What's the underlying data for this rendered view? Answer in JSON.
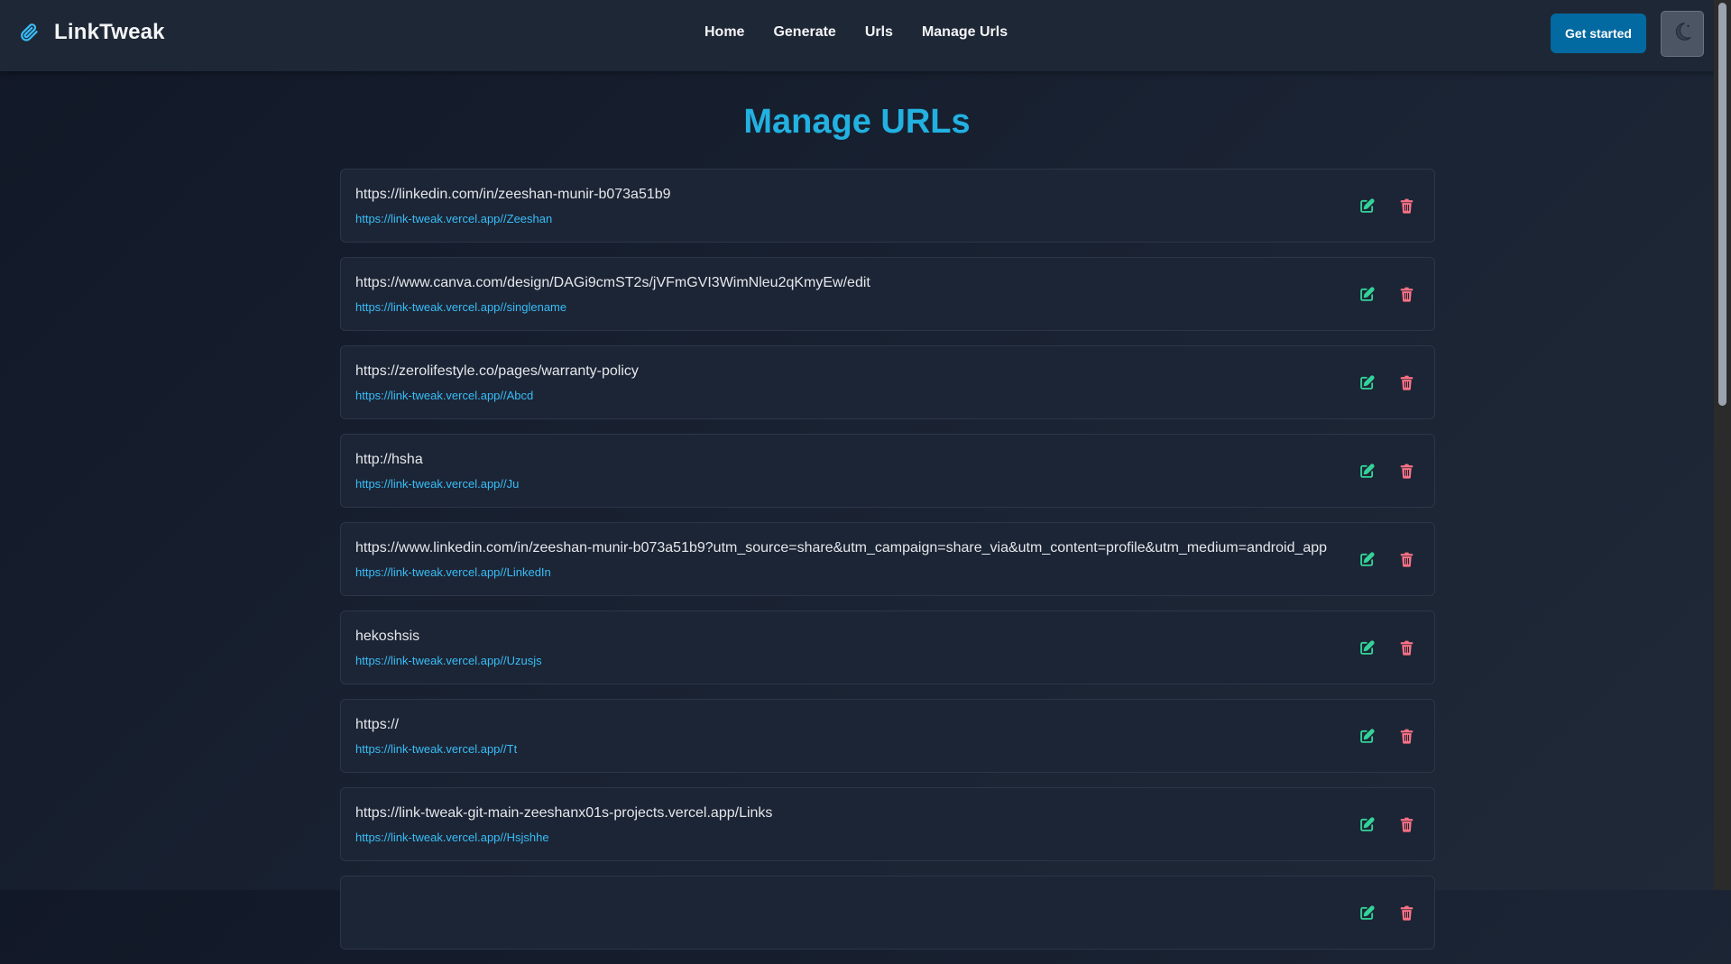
{
  "app": {
    "name": "LinkTweak"
  },
  "nav": {
    "links": [
      "Home",
      "Generate",
      "Urls",
      "Manage Urls"
    ],
    "cta_label": "Get started"
  },
  "page": {
    "title": "Manage URLs"
  },
  "colors": {
    "accent_title": "#22b1e0",
    "link": "#38bdf8",
    "edit_icon": "#34d399",
    "delete_icon": "#fb7185",
    "button": "#0369a1"
  },
  "icons": {
    "brand": "paperclip-icon",
    "theme": "moon-icon",
    "edit": "edit-icon",
    "delete": "trash-icon"
  },
  "urls": [
    {
      "original": "https://linkedin.com/in/zeeshan-munir-b073a51b9",
      "short": "https://link-tweak.vercel.app//Zeeshan"
    },
    {
      "original": "https://www.canva.com/design/DAGi9cmST2s/jVFmGVI3WimNleu2qKmyEw/edit",
      "short": "https://link-tweak.vercel.app//singlename"
    },
    {
      "original": "https://zerolifestyle.co/pages/warranty-policy",
      "short": "https://link-tweak.vercel.app//Abcd"
    },
    {
      "original": "http://hsha",
      "short": "https://link-tweak.vercel.app//Ju"
    },
    {
      "original": "https://www.linkedin.com/in/zeeshan-munir-b073a51b9?utm_source=share&utm_campaign=share_via&utm_content=profile&utm_medium=android_app",
      "short": "https://link-tweak.vercel.app//LinkedIn"
    },
    {
      "original": "hekoshsis",
      "short": "https://link-tweak.vercel.app//Uzusjs"
    },
    {
      "original": "https://",
      "short": "https://link-tweak.vercel.app//Tt"
    },
    {
      "original": "https://link-tweak-git-main-zeeshanx01s-projects.vercel.app/Links",
      "short": "https://link-tweak.vercel.app//Hsjshhe"
    },
    {
      "original": "",
      "short": ""
    }
  ]
}
